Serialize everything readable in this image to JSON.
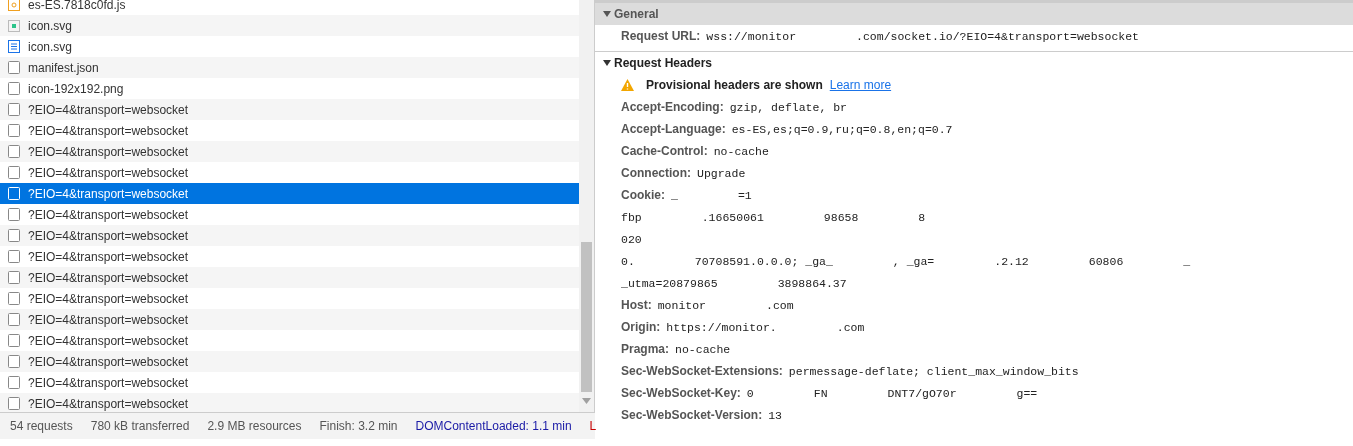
{
  "requests": [
    {
      "name": "es-ES.7818c0fd.js",
      "kind": "script",
      "selected": false
    },
    {
      "name": "icon.svg",
      "kind": "image",
      "selected": false
    },
    {
      "name": "icon.svg",
      "kind": "document",
      "selected": false
    },
    {
      "name": "manifest.json",
      "kind": "other",
      "selected": false
    },
    {
      "name": "icon-192x192.png",
      "kind": "other",
      "selected": false
    },
    {
      "name": "?EIO=4&transport=websocket",
      "kind": "other",
      "selected": false
    },
    {
      "name": "?EIO=4&transport=websocket",
      "kind": "other",
      "selected": false
    },
    {
      "name": "?EIO=4&transport=websocket",
      "kind": "other",
      "selected": false
    },
    {
      "name": "?EIO=4&transport=websocket",
      "kind": "other",
      "selected": false
    },
    {
      "name": "?EIO=4&transport=websocket",
      "kind": "other",
      "selected": true
    },
    {
      "name": "?EIO=4&transport=websocket",
      "kind": "other",
      "selected": false
    },
    {
      "name": "?EIO=4&transport=websocket",
      "kind": "other",
      "selected": false
    },
    {
      "name": "?EIO=4&transport=websocket",
      "kind": "other",
      "selected": false
    },
    {
      "name": "?EIO=4&transport=websocket",
      "kind": "other",
      "selected": false
    },
    {
      "name": "?EIO=4&transport=websocket",
      "kind": "other",
      "selected": false
    },
    {
      "name": "?EIO=4&transport=websocket",
      "kind": "other",
      "selected": false
    },
    {
      "name": "?EIO=4&transport=websocket",
      "kind": "other",
      "selected": false
    },
    {
      "name": "?EIO=4&transport=websocket",
      "kind": "other",
      "selected": false
    },
    {
      "name": "?EIO=4&transport=websocket",
      "kind": "other",
      "selected": false
    },
    {
      "name": "?EIO=4&transport=websocket",
      "kind": "other",
      "selected": false
    }
  ],
  "status_bar": [
    {
      "text": "54 requests",
      "kind": "plain"
    },
    {
      "text": "780 kB transferred",
      "kind": "plain"
    },
    {
      "text": "2.9 MB resources",
      "kind": "plain"
    },
    {
      "text": "Finish: 3.2 min",
      "kind": "plain"
    },
    {
      "text": "DOMContentLoaded: 1.1 min",
      "kind": "dom"
    },
    {
      "text": "L",
      "kind": "load"
    }
  ],
  "general": {
    "title": "General",
    "expanded": true,
    "request_url": {
      "label": "Request URL:",
      "value": [
        "wss://monitor",
        ".com/socket.io/?EIO=4&transport=websocket"
      ]
    }
  },
  "request_headers": {
    "title": "Request Headers",
    "expanded": true,
    "warning": {
      "text": "Provisional headers are shown",
      "link": "Learn more"
    },
    "headers": [
      {
        "name": "Accept-Encoding:",
        "value": [
          [
            "gzip, deflate, br"
          ]
        ]
      },
      {
        "name": "Accept-Language:",
        "value": [
          [
            "es-ES,es;q=0.9,ru;q=0.8,en;q=0.7"
          ]
        ]
      },
      {
        "name": "Cache-Control:",
        "value": [
          [
            "no-cache"
          ]
        ]
      },
      {
        "name": "Connection:",
        "value": [
          [
            "Upgrade"
          ]
        ]
      },
      {
        "name": "Cookie:",
        "value": [
          [
            "_",
            "=1"
          ],
          [
            "fbp",
            ".16650061",
            "98658",
            "8"
          ],
          [
            "020"
          ],
          [
            "0.",
            "70708591.0.0.0; _ga_",
            ", _ga=",
            ".2.12",
            "60806",
            "_"
          ],
          [
            "_utma=20879865",
            "3898864.37"
          ]
        ]
      },
      {
        "name": "Host:",
        "value": [
          [
            "monitor",
            ".com"
          ]
        ]
      },
      {
        "name": "Origin:",
        "value": [
          [
            "https://monitor.",
            ".com"
          ]
        ]
      },
      {
        "name": "Pragma:",
        "value": [
          [
            "no-cache"
          ]
        ]
      },
      {
        "name": "Sec-WebSocket-Extensions:",
        "value": [
          [
            "permessage-deflate; client_max_window_bits"
          ]
        ]
      },
      {
        "name": "Sec-WebSocket-Key:",
        "value": [
          [
            "0",
            "FN",
            "DNT7/gO70r",
            "g=="
          ]
        ]
      },
      {
        "name": "Sec-WebSocket-Version:",
        "value": [
          [
            "13"
          ]
        ]
      }
    ]
  }
}
